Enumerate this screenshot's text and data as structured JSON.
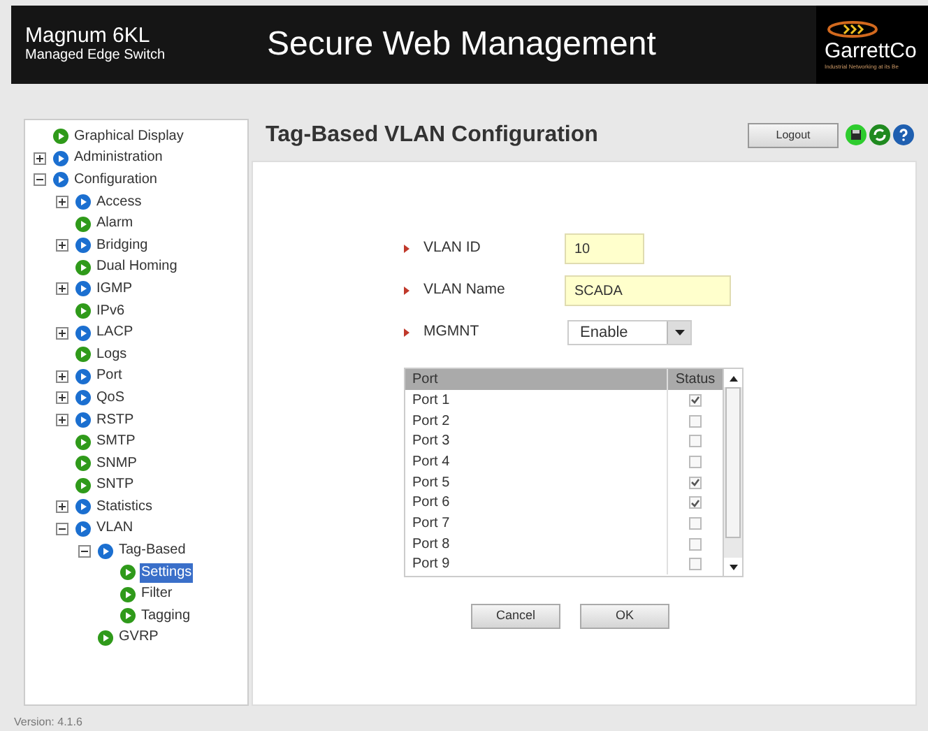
{
  "header": {
    "product": "Magnum 6KL",
    "subtitle": "Managed Edge Switch",
    "title": "Secure Web Management",
    "logo": "GarrettCo",
    "tagline": "Industrial Networking at its Be"
  },
  "sidebar": {
    "items": [
      {
        "label": "Graphical Display",
        "kind": "leaf",
        "selected": false
      },
      {
        "label": "Administration",
        "kind": "folder",
        "expanded": false
      },
      {
        "label": "Configuration",
        "kind": "folder",
        "expanded": true,
        "children": [
          {
            "label": "Access",
            "kind": "folder",
            "expanded": false
          },
          {
            "label": "Alarm",
            "kind": "leaf",
            "selected": false
          },
          {
            "label": "Bridging",
            "kind": "folder",
            "expanded": false
          },
          {
            "label": "Dual Homing",
            "kind": "leaf",
            "selected": false
          },
          {
            "label": "IGMP",
            "kind": "folder",
            "expanded": false
          },
          {
            "label": "IPv6",
            "kind": "leaf",
            "selected": false
          },
          {
            "label": "LACP",
            "kind": "folder",
            "expanded": false
          },
          {
            "label": "Logs",
            "kind": "leaf",
            "selected": false
          },
          {
            "label": "Port",
            "kind": "folder",
            "expanded": false
          },
          {
            "label": "QoS",
            "kind": "folder",
            "expanded": false
          },
          {
            "label": "RSTP",
            "kind": "folder",
            "expanded": false
          },
          {
            "label": "SMTP",
            "kind": "leaf",
            "selected": false
          },
          {
            "label": "SNMP",
            "kind": "leaf",
            "selected": false
          },
          {
            "label": "SNTP",
            "kind": "leaf",
            "selected": false
          },
          {
            "label": "Statistics",
            "kind": "folder",
            "expanded": false
          },
          {
            "label": "VLAN",
            "kind": "folder",
            "expanded": true,
            "children": [
              {
                "label": "Tag-Based",
                "kind": "folder",
                "expanded": true,
                "children": [
                  {
                    "label": "Settings",
                    "kind": "leaf",
                    "selected": true
                  },
                  {
                    "label": "Filter",
                    "kind": "leaf",
                    "selected": false
                  },
                  {
                    "label": "Tagging",
                    "kind": "leaf",
                    "selected": false
                  }
                ]
              },
              {
                "label": "GVRP",
                "kind": "leaf",
                "selected": false
              }
            ]
          }
        ]
      }
    ],
    "version": "Version: 4.1.6"
  },
  "page": {
    "title": "Tag-Based VLAN Configuration",
    "logout": "Logout"
  },
  "form": {
    "vlan_id": {
      "label": "VLAN ID",
      "value": "10"
    },
    "vlan_name": {
      "label": "VLAN Name",
      "value": "SCADA"
    },
    "mgmnt": {
      "label": "MGMNT",
      "value": "Enable"
    }
  },
  "table": {
    "columns": [
      "Port",
      "Status"
    ],
    "rows": [
      {
        "port": "Port 1",
        "checked": true
      },
      {
        "port": "Port 2",
        "checked": false
      },
      {
        "port": "Port 3",
        "checked": false
      },
      {
        "port": "Port 4",
        "checked": false
      },
      {
        "port": "Port 5",
        "checked": true
      },
      {
        "port": "Port 6",
        "checked": true
      },
      {
        "port": "Port 7",
        "checked": false
      },
      {
        "port": "Port 8",
        "checked": false
      },
      {
        "port": "Port 9",
        "checked": false
      }
    ]
  },
  "buttons": [
    "Cancel",
    "OK"
  ]
}
